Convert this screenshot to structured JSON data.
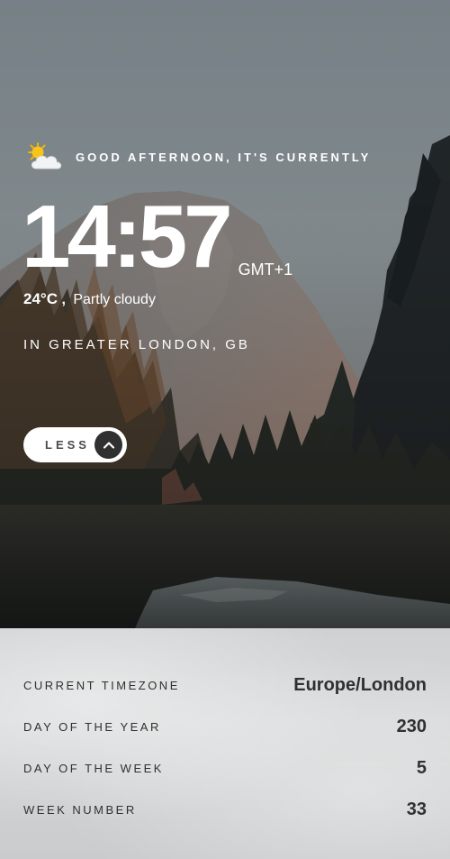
{
  "greeting": {
    "text": "GOOD AFTERNOON, IT'S CURRENTLY",
    "icon": "partly-cloudy-icon"
  },
  "time": {
    "clock": "14:57",
    "tz_abbr": "GMT+1"
  },
  "weather": {
    "temperature": "24°C",
    "separator": ",",
    "condition": "Partly cloudy"
  },
  "location": "IN GREATER LONDON, GB",
  "toggle": {
    "label": "LESS",
    "icon": "chevron-up-icon"
  },
  "details": [
    {
      "label": "CURRENT TIMEZONE",
      "value": "Europe/London"
    },
    {
      "label": "DAY OF THE YEAR",
      "value": "230"
    },
    {
      "label": "DAY OF THE WEEK",
      "value": "5"
    },
    {
      "label": "WEEK NUMBER",
      "value": "33"
    }
  ],
  "colors": {
    "sky": "#7f8a90",
    "panel": "#d3d5d6",
    "text_dark": "#303030",
    "button_arrow_bg": "#303030"
  }
}
